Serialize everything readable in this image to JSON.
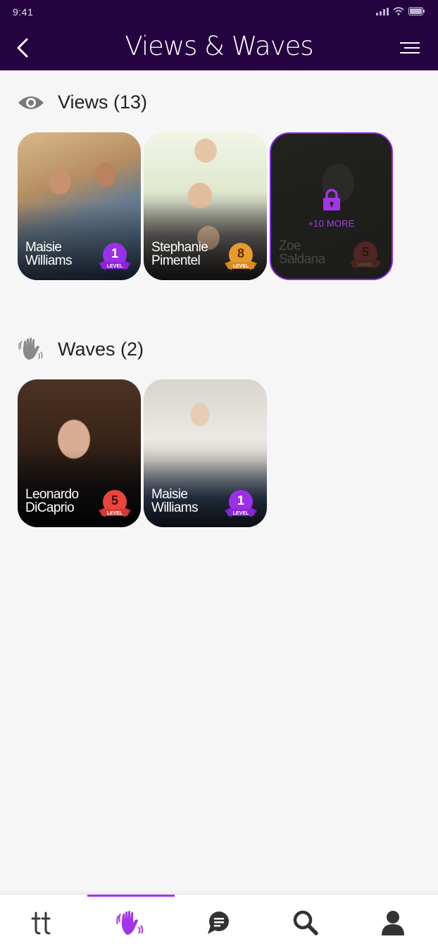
{
  "status_bar": {
    "time": "9:41"
  },
  "header": {
    "title": "Views & Waves"
  },
  "views": {
    "label": "Views (13)",
    "cards": [
      {
        "first": "Maisie",
        "last": "Williams",
        "level": "1",
        "level_word": "LEVEL",
        "badge_color": "#9b30e8"
      },
      {
        "first": "Stephanie",
        "last": "Pimentel",
        "level": "8",
        "level_word": "LEVEL",
        "badge_color": "#e89a2c"
      },
      {
        "first": "Zoe",
        "last": "Saldana",
        "level": "5",
        "level_word": "LEVEL",
        "badge_color": "#e8463c",
        "locked": true,
        "more_text": "+10 MORE"
      }
    ]
  },
  "waves": {
    "label": "Waves (2)",
    "cards": [
      {
        "first": "Leonardo",
        "last": "DiCaprio",
        "level": "5",
        "level_word": "LEVEL",
        "badge_color": "#e8463c"
      },
      {
        "first": "Maisie",
        "last": "Williams",
        "level": "1",
        "level_word": "LEVEL",
        "badge_color": "#9b30e8"
      }
    ]
  },
  "bottom_nav": {
    "items": [
      {
        "icon": "logo-icon"
      },
      {
        "icon": "wave-hand-icon",
        "active": true
      },
      {
        "icon": "chat-icon"
      },
      {
        "icon": "search-icon"
      },
      {
        "icon": "profile-icon"
      }
    ]
  },
  "colors": {
    "header_bg": "#250240",
    "accent": "#a334ec"
  }
}
